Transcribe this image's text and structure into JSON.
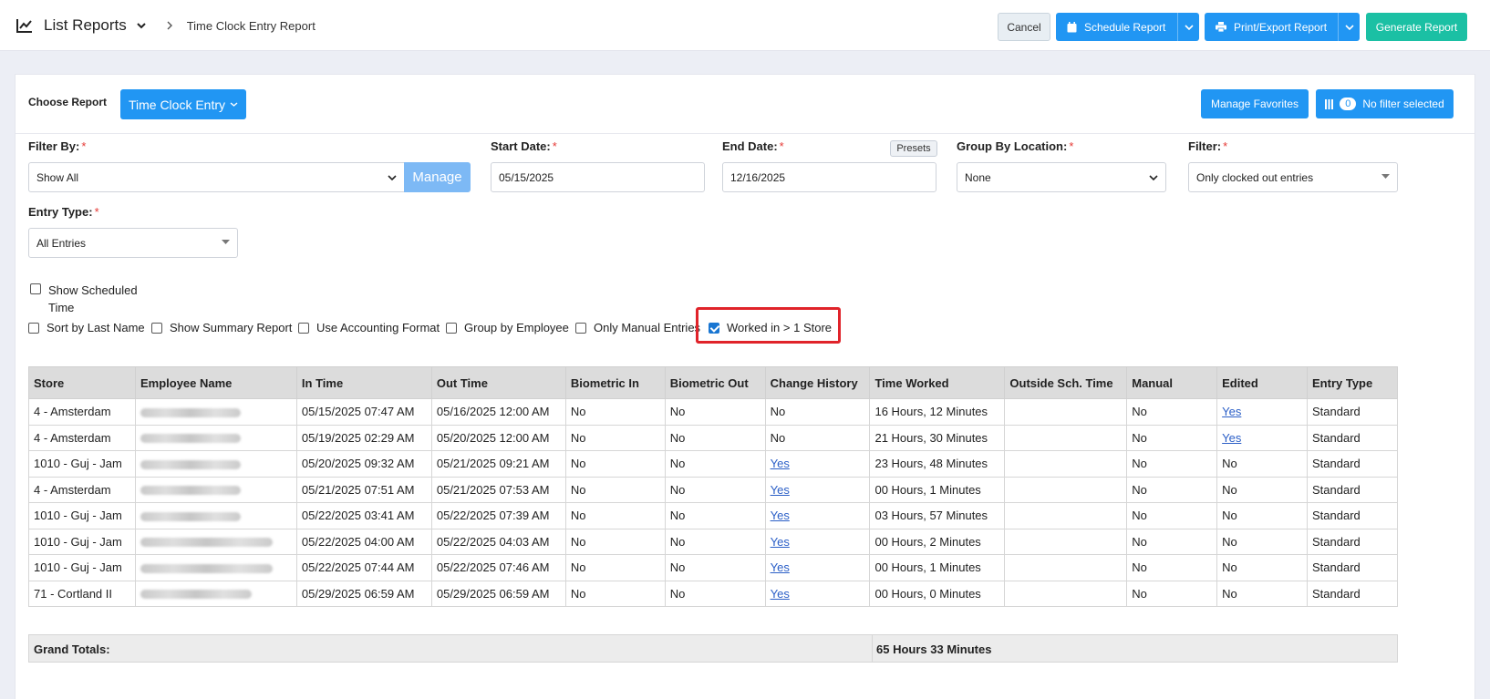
{
  "header": {
    "title": "List Reports",
    "breadcrumb": "Time Clock Entry Report",
    "buttons": {
      "cancel": "Cancel",
      "schedule": "Schedule Report",
      "print": "Print/Export Report",
      "generate": "Generate Report"
    }
  },
  "choose": {
    "label": "Choose Report",
    "report": "Time Clock Entry",
    "favorites": "Manage Favorites",
    "filter_count": "0",
    "filter_label": "No filter selected"
  },
  "filters": {
    "filter_by": {
      "label": "Filter By:",
      "value": "Show All",
      "manage": "Manage"
    },
    "start_date": {
      "label": "Start Date:",
      "value": "05/15/2025"
    },
    "end_date": {
      "label": "End Date:",
      "value": "12/16/2025",
      "presets": "Presets"
    },
    "group_by_location": {
      "label": "Group By Location:",
      "value": "None"
    },
    "filter": {
      "label": "Filter:",
      "value": "Only clocked out entries"
    },
    "entry_type": {
      "label": "Entry Type:",
      "value": "All Entries"
    },
    "required_mark": "*"
  },
  "options": {
    "show_scheduled_line1": "Show Scheduled",
    "show_scheduled_line2": "Time",
    "sort_last_name": "Sort by Last Name",
    "show_summary": "Show Summary Report",
    "accounting": "Use Accounting Format",
    "group_employee": "Group by Employee",
    "manual_entries": "Only Manual Entries",
    "worked_multi": "Worked in > 1 Store"
  },
  "table": {
    "headers": [
      "Store",
      "Employee Name",
      "In Time",
      "Out Time",
      "Biometric In",
      "Biometric Out",
      "Change History",
      "Time Worked",
      "Outside Sch. Time",
      "Manual",
      "Edited",
      "Entry Type"
    ],
    "rows": [
      {
        "store": "4 - Amsterdam",
        "in": "05/15/2025 07:47 AM",
        "out": "05/16/2025 12:00 AM",
        "bio_in": "No",
        "bio_out": "No",
        "history": "No",
        "worked": "16 Hours, 12 Minutes",
        "outside": "",
        "manual": "No",
        "edited": "Yes",
        "type": "Standard"
      },
      {
        "store": "4 - Amsterdam",
        "in": "05/19/2025 02:29 AM",
        "out": "05/20/2025 12:00 AM",
        "bio_in": "No",
        "bio_out": "No",
        "history": "No",
        "worked": "21 Hours, 30 Minutes",
        "outside": "",
        "manual": "No",
        "edited": "Yes",
        "type": "Standard"
      },
      {
        "store": "1010 - Guj - Jam",
        "in": "05/20/2025 09:32 AM",
        "out": "05/21/2025 09:21 AM",
        "bio_in": "No",
        "bio_out": "No",
        "history": "Yes",
        "worked": "23 Hours, 48 Minutes",
        "outside": "",
        "manual": "No",
        "edited": "No",
        "type": "Standard"
      },
      {
        "store": "4 - Amsterdam",
        "in": "05/21/2025 07:51 AM",
        "out": "05/21/2025 07:53 AM",
        "bio_in": "No",
        "bio_out": "No",
        "history": "Yes",
        "worked": "00 Hours, 1 Minutes",
        "outside": "",
        "manual": "No",
        "edited": "No",
        "type": "Standard"
      },
      {
        "store": "1010 - Guj - Jam",
        "in": "05/22/2025 03:41 AM",
        "out": "05/22/2025 07:39 AM",
        "bio_in": "No",
        "bio_out": "No",
        "history": "Yes",
        "worked": "03 Hours, 57 Minutes",
        "outside": "",
        "manual": "No",
        "edited": "No",
        "type": "Standard"
      },
      {
        "store": "1010 - Guj - Jam",
        "in": "05/22/2025 04:00 AM",
        "out": "05/22/2025 04:03 AM",
        "bio_in": "No",
        "bio_out": "No",
        "history": "Yes",
        "worked": "00 Hours, 2 Minutes",
        "outside": "",
        "manual": "No",
        "edited": "No",
        "type": "Standard"
      },
      {
        "store": "1010 - Guj - Jam",
        "in": "05/22/2025 07:44 AM",
        "out": "05/22/2025 07:46 AM",
        "bio_in": "No",
        "bio_out": "No",
        "history": "Yes",
        "worked": "00 Hours, 1 Minutes",
        "outside": "",
        "manual": "No",
        "edited": "No",
        "type": "Standard"
      },
      {
        "store": "71 - Cortland II",
        "in": "05/29/2025 06:59 AM",
        "out": "05/29/2025 06:59 AM",
        "bio_in": "No",
        "bio_out": "No",
        "history": "Yes",
        "worked": "00 Hours, 0 Minutes",
        "outside": "",
        "manual": "No",
        "edited": "No",
        "type": "Standard"
      }
    ],
    "totals_label": "Grand Totals:",
    "totals_value": "65 Hours 33 Minutes"
  }
}
